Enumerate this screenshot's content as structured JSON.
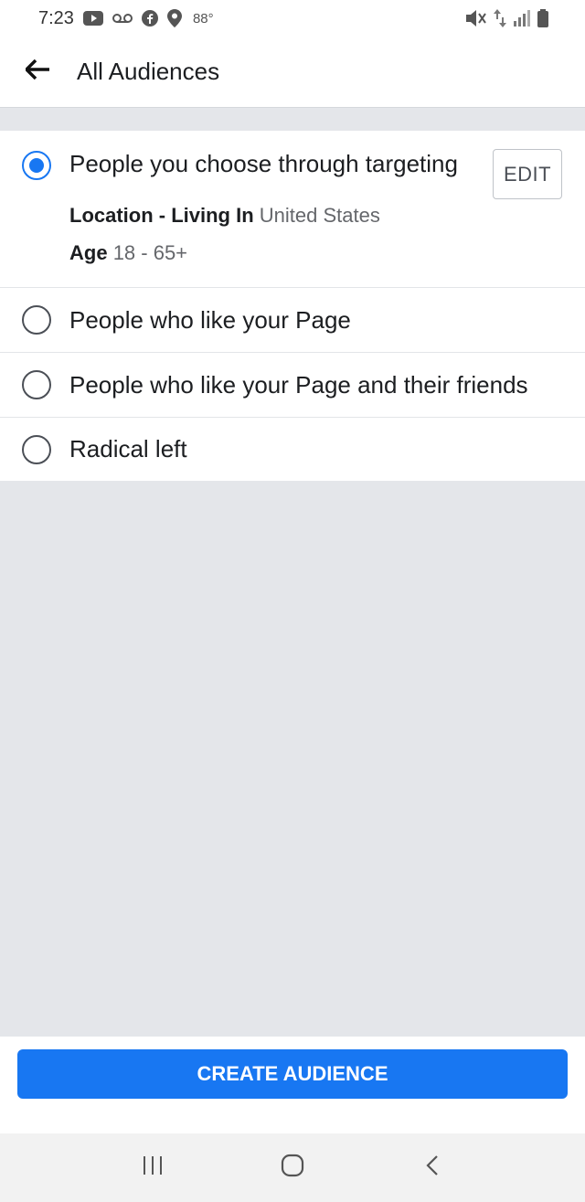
{
  "status_bar": {
    "time": "7:23",
    "temperature": "88°",
    "left_icons": [
      "youtube-icon",
      "voicemail-icon",
      "facebook-icon",
      "location-pin-icon"
    ],
    "right_icons": [
      "mute-icon",
      "data-arrows-icon",
      "signal-icon",
      "battery-icon"
    ]
  },
  "header": {
    "title": "All Audiences",
    "back_icon": "arrow-left-icon"
  },
  "audiences": {
    "selected": {
      "label": "People you choose through targeting",
      "edit_label": "EDIT",
      "location_key": "Location - Living In",
      "location_value": "United States",
      "age_key": "Age",
      "age_value": "18 - 65+"
    },
    "options": [
      {
        "label": "People who like your Page"
      },
      {
        "label": "People who like your Page and their friends"
      },
      {
        "label": "Radical left"
      }
    ]
  },
  "footer": {
    "create_label": "CREATE AUDIENCE"
  },
  "nav": {
    "icons": [
      "recent-apps-icon",
      "home-icon",
      "back-icon"
    ]
  },
  "colors": {
    "accent": "#1877f2",
    "background": "#e4e6ea"
  }
}
